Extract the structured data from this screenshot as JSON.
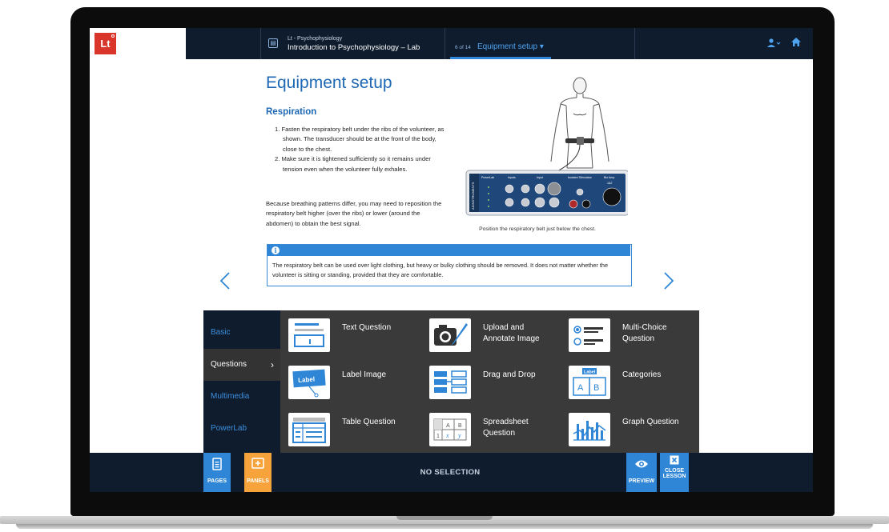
{
  "app": {
    "logo_text": "Lt",
    "course_subtitle": "Lt - Psychophysiology",
    "course_title": "Introduction to Psychophysiology – Lab",
    "page_count": "6 of 14",
    "page_title": "Equipment setup",
    "dropdown_glyph": "▾",
    "user_icon": "user-icon",
    "home_icon": "home-icon"
  },
  "content": {
    "heading": "Equipment setup",
    "subheading": "Respiration",
    "steps": [
      "1. Fasten the respiratory belt under the ribs of the volunteer, as shown. The transducer should be at the front of the body, close to the chest.",
      "2. Make sure it is tightened sufficiently so it remains under tension even when the volunteer fully exhales."
    ],
    "paragraph": "Because breathing patterns differ, you may need to reposition the respiratory belt higher (over the ribs) or lower (around the abdomen) to obtain the best signal.",
    "figure_caption": "Position the respiratory belt just below the chest.",
    "device_labels": [
      "PowerLab",
      "Inputs",
      "Input",
      "Isolated Stimulator",
      "Bio Amp",
      "1&2",
      "3&4",
      "ADINSTRUMENTS"
    ],
    "note": "The respiratory belt can be used over light clothing, but heavy or bulky clothing should be removed. It does not matter whether the volunteer is sitting or standing, provided that they are comfortable.",
    "prev_glyph": "‹",
    "next_glyph": "›"
  },
  "panel": {
    "categories": [
      {
        "label": "Basic"
      },
      {
        "label": "Questions"
      },
      {
        "label": "Multimedia"
      },
      {
        "label": "PowerLab"
      }
    ],
    "active_chevron": "›",
    "tiles": [
      {
        "label": "Text Question",
        "icon": "text-question-icon"
      },
      {
        "label": "Upload and Annotate Image",
        "icon": "camera-pen-icon"
      },
      {
        "label": "Multi-Choice Question",
        "icon": "multi-choice-icon"
      },
      {
        "label": "Label Image",
        "icon": "label-image-icon"
      },
      {
        "label": "Drag and Drop",
        "icon": "drag-drop-icon"
      },
      {
        "label": "Categories",
        "icon": "categories-icon"
      },
      {
        "label": "Table Question",
        "icon": "table-question-icon"
      },
      {
        "label": "Spreadsheet Question",
        "icon": "spreadsheet-icon"
      },
      {
        "label": "Graph Question",
        "icon": "graph-question-icon"
      }
    ],
    "icon_text": {
      "label": "Label",
      "a": "A",
      "b": "B",
      "x": "x",
      "y": "y",
      "one": "1"
    }
  },
  "bottombar": {
    "pages_label": "PAGES",
    "panels_label": "PANELS",
    "status": "NO SELECTION",
    "preview_label": "PREVIEW",
    "close_label_1": "CLOSE",
    "close_label_2": "LESSON"
  },
  "colors": {
    "navy": "#0f1c2e",
    "accent_blue": "#2f86d6",
    "panels_orange": "#f5a33a",
    "panel_grey": "#3a3a3a"
  }
}
